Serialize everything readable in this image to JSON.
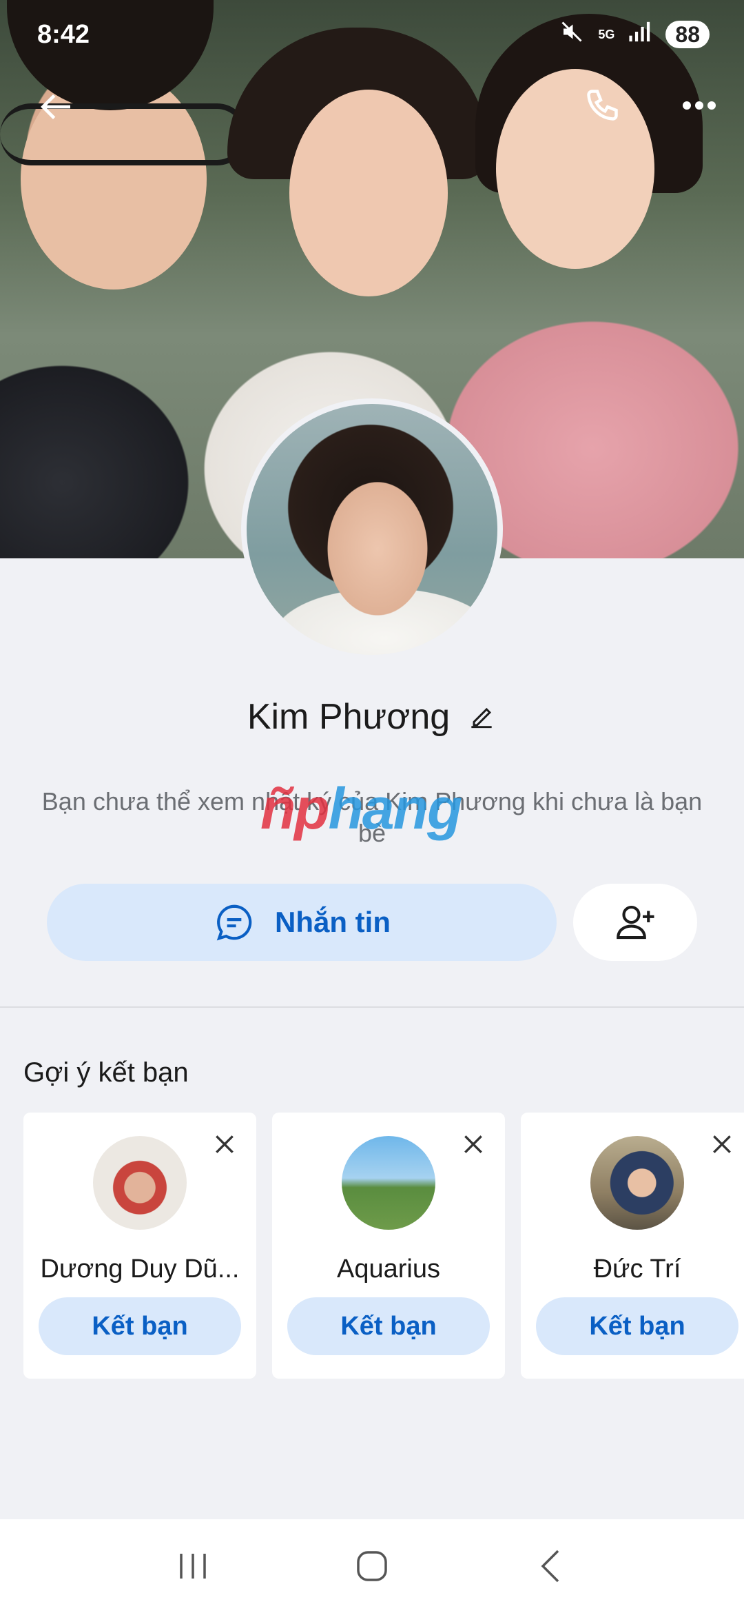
{
  "status_bar": {
    "time": "8:42",
    "network": "5G",
    "battery": "88",
    "icons": [
      "mute-icon",
      "signal-icon",
      "battery-icon"
    ]
  },
  "header": {
    "back_icon": "back-arrow-icon",
    "call_icon": "phone-icon",
    "more_icon": "more-dots-icon"
  },
  "profile": {
    "name": "Kim Phương",
    "notice": "Bạn chưa thể xem nhật ký của Kim Phương khi chưa là bạn bè",
    "watermark_a": "ñp",
    "watermark_b": "hang"
  },
  "actions": {
    "message_label": "Nhắn tin",
    "message_icon": "chat-bubble-icon",
    "add_friend_icon": "add-user-icon"
  },
  "suggestions": {
    "title": "Gợi ý kết bạn",
    "items": [
      {
        "name": "Dương Duy Dũ...",
        "button": "Kết bạn"
      },
      {
        "name": "Aquarius",
        "button": "Kết bạn"
      },
      {
        "name": "Đức Trí",
        "button": "Kết bạn"
      }
    ]
  },
  "colors": {
    "accent": "#0a5fc4",
    "button_bg": "#d9e8fb",
    "background": "#f0f1f5"
  }
}
